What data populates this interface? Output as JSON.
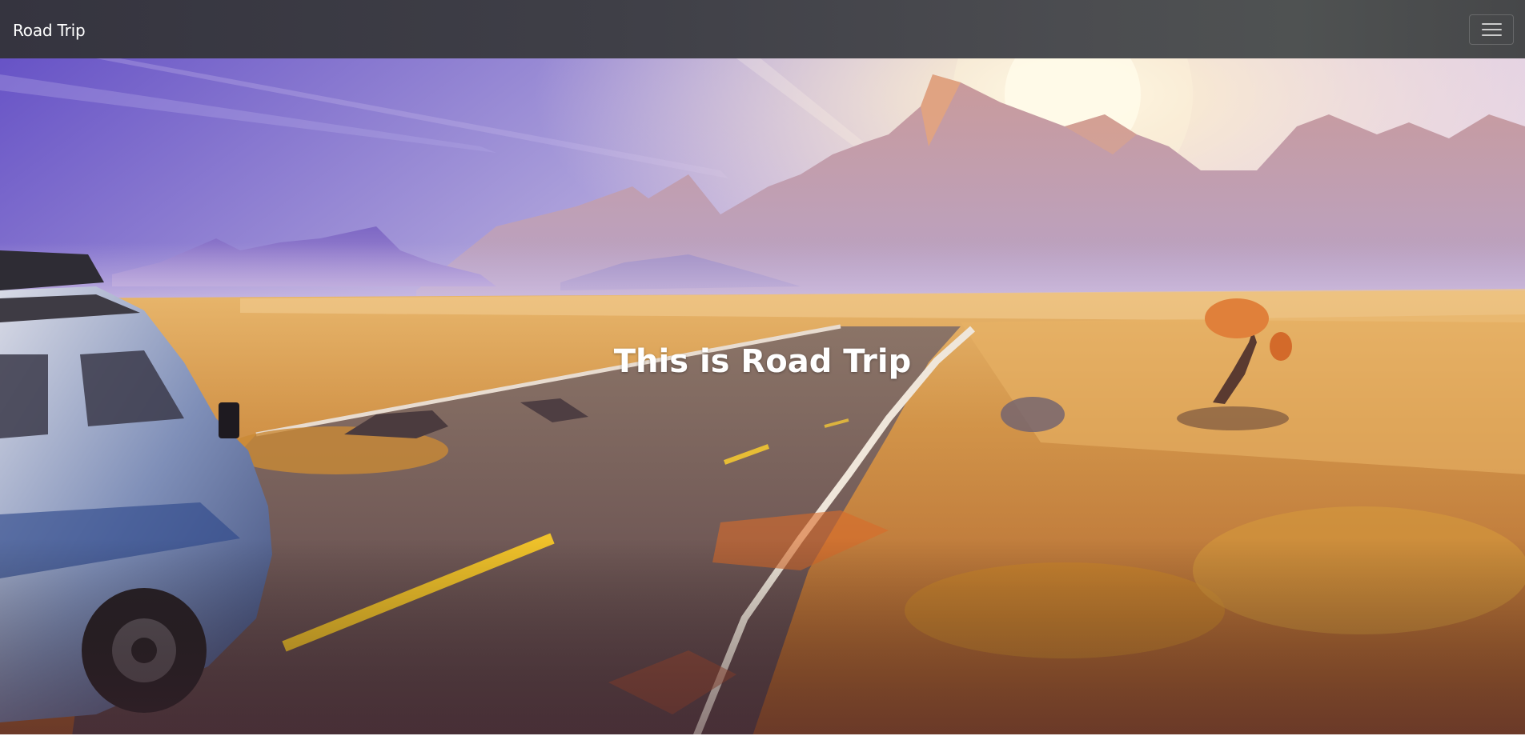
{
  "navbar": {
    "brand": "Road Trip",
    "toggler_icon": "hamburger-menu-icon"
  },
  "hero": {
    "title": "This is Road Trip",
    "image": "road-trip-desert-landscape"
  },
  "colors": {
    "navbar_bg": "#3f3f47",
    "sky_top": "#6b5fc8",
    "sun": "#fff6d8",
    "desert": "#c98a3e",
    "road": "#6e5a55"
  }
}
